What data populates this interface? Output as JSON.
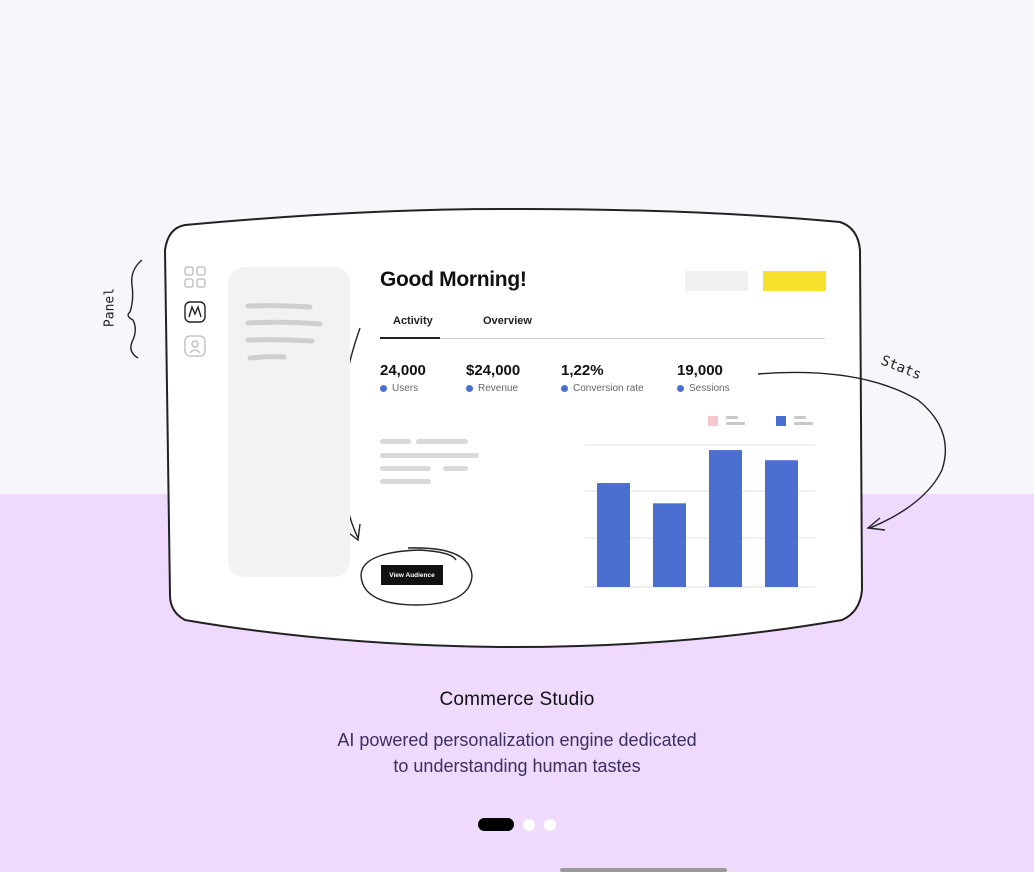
{
  "annotations": {
    "panel_label": "Panel",
    "stats_label": "Stats"
  },
  "dashboard": {
    "greeting": "Good Morning!",
    "tabs": [
      {
        "label": "Activity",
        "active": true
      },
      {
        "label": "Overview",
        "active": false
      }
    ],
    "stats": [
      {
        "value": "24,000",
        "label": "Users"
      },
      {
        "value": "$24,000",
        "label": "Revenue"
      },
      {
        "value": "1,22%",
        "label": "Conversion rate"
      },
      {
        "value": "19,000",
        "label": "Sessions"
      }
    ],
    "view_button": "View Audience",
    "nav_icons": [
      "grid-icon",
      "m-logo-icon",
      "user-icon"
    ],
    "accent_color": "#f8e22d",
    "bar_color": "#4a6fd1",
    "legend_pink": "#f7c6cc"
  },
  "chart_data": {
    "type": "bar",
    "values": [
      82,
      66,
      108,
      100
    ]
  },
  "caption": {
    "title": "Commerce Studio",
    "description_line1": "AI powered personalization engine dedicated",
    "description_line2": "to understanding human tastes"
  },
  "carousel": {
    "total": 3,
    "active_index": 0
  }
}
